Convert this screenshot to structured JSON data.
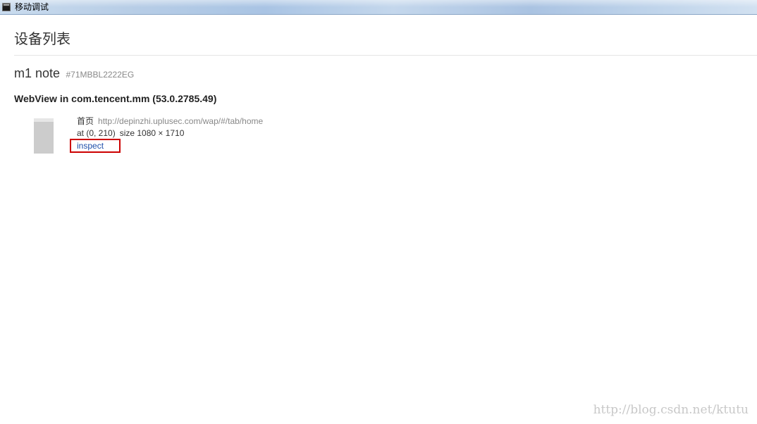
{
  "window": {
    "title": "移动调试",
    "icon": "console-window-icon"
  },
  "page": {
    "heading": "设备列表"
  },
  "device": {
    "name": "m1 note",
    "serial": "#71MBBL2222EG",
    "webview": {
      "label": "WebView in com.tencent.mm (53.0.2785.49)",
      "pages": [
        {
          "title": "首页",
          "url": "http://depinzhi.uplusec.com/wap/#/tab/home",
          "position": "at (0, 210)",
          "size": "size 1080 × 1710",
          "action_label": "inspect"
        }
      ]
    }
  },
  "watermark": "http://blog.csdn.net/ktutu",
  "colors": {
    "link": "#1e4eaa",
    "highlight_border": "#cc0000",
    "muted_text": "#888888"
  }
}
